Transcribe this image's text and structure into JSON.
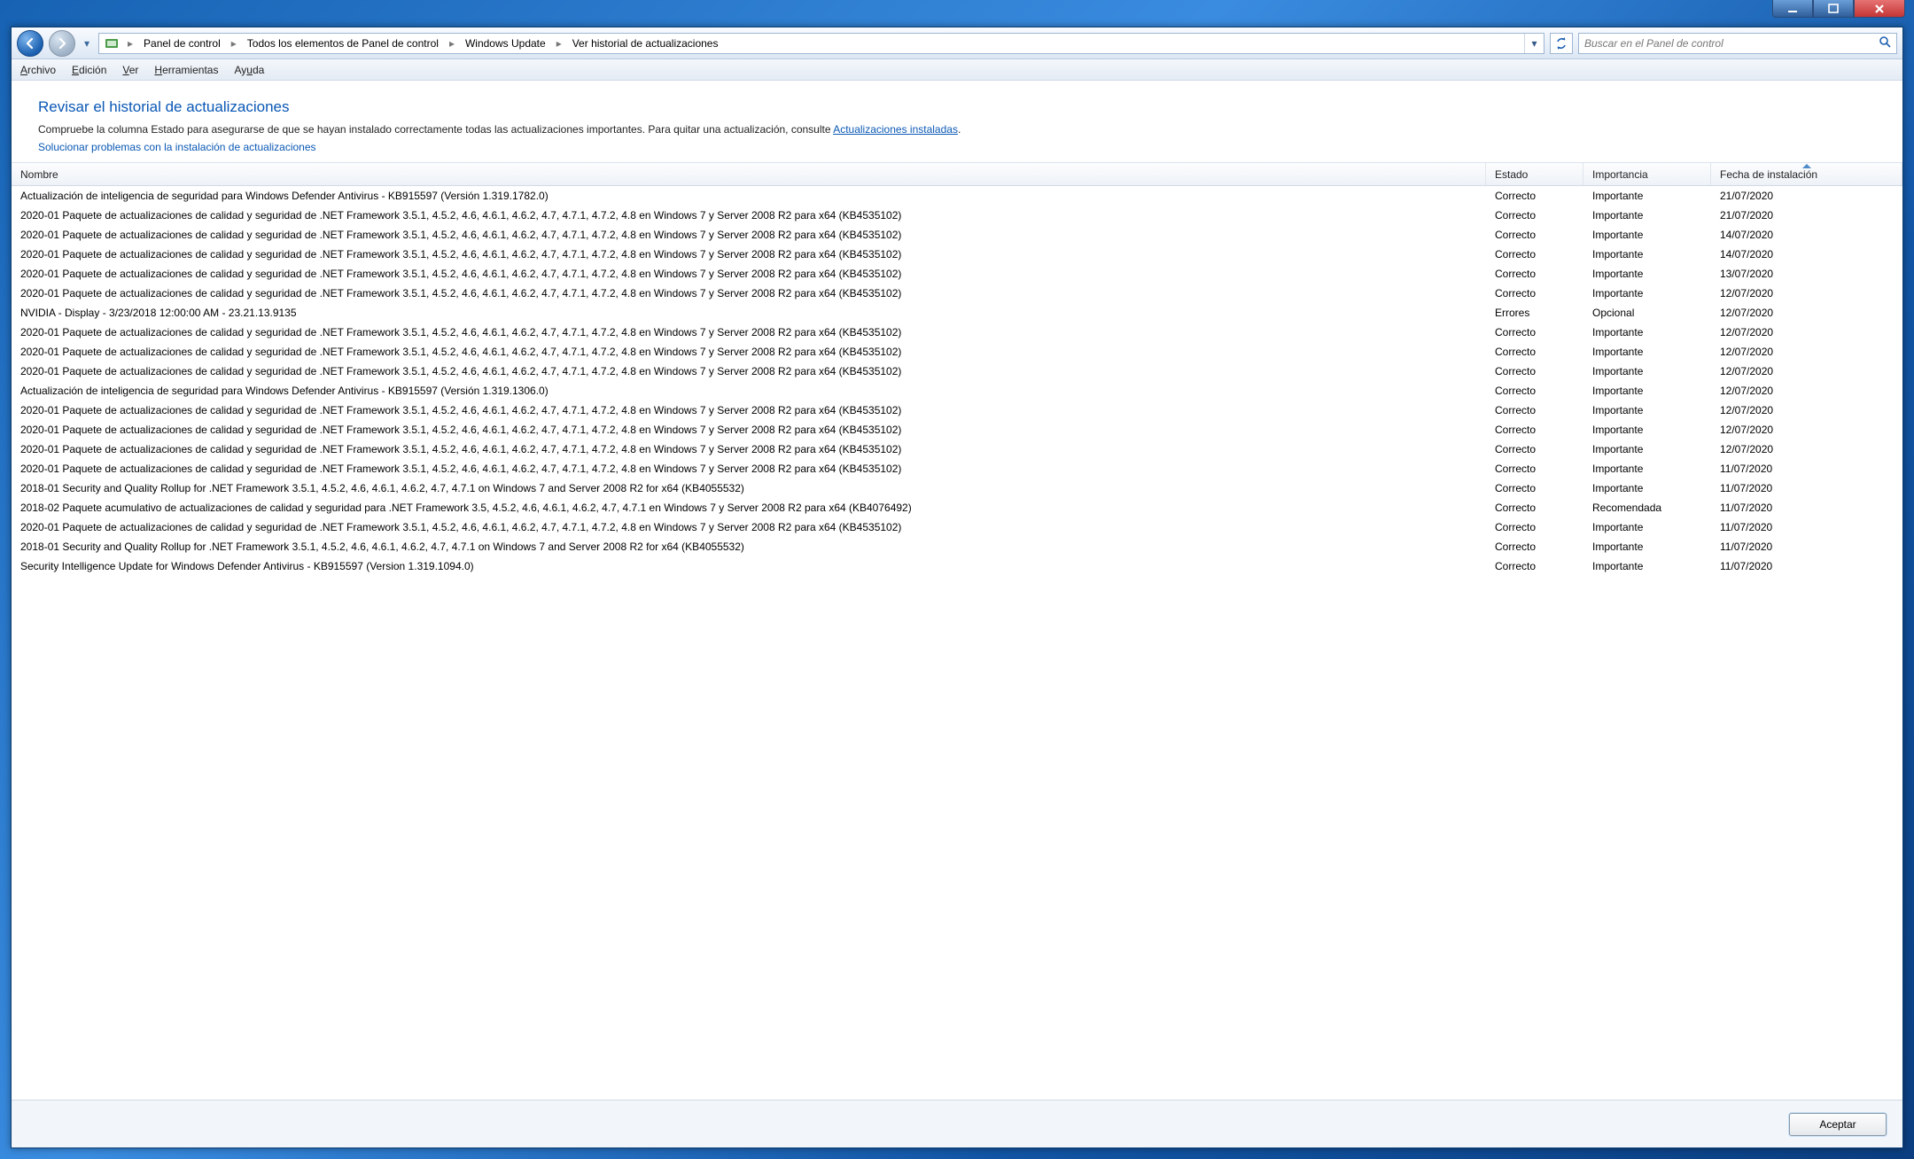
{
  "breadcrumbs": {
    "items": [
      "Panel de control",
      "Todos los elementos de Panel de control",
      "Windows Update",
      "Ver historial de actualizaciones"
    ]
  },
  "search": {
    "placeholder": "Buscar en el Panel de control"
  },
  "menu": {
    "file": "Archivo",
    "edit": "Edición",
    "view": "Ver",
    "tools": "Herramientas",
    "help": "Ayuda"
  },
  "header": {
    "title": "Revisar el historial de actualizaciones",
    "desc_prefix": "Compruebe la columna Estado para asegurarse de que se hayan instalado correctamente todas las actualizaciones importantes. Para quitar una actualización, consulte ",
    "desc_link": "Actualizaciones instaladas",
    "desc_suffix": ".",
    "sub_link": "Solucionar problemas con la instalación de actualizaciones"
  },
  "columns": {
    "name": "Nombre",
    "status": "Estado",
    "importance": "Importancia",
    "date": "Fecha de instalación"
  },
  "rows": [
    {
      "name": "Actualización de inteligencia de seguridad para Windows Defender Antivirus - KB915597 (Versión 1.319.1782.0)",
      "status": "Correcto",
      "importance": "Importante",
      "date": "21/07/2020"
    },
    {
      "name": "2020-01 Paquete de actualizaciones de calidad y seguridad de .NET Framework 3.5.1, 4.5.2, 4.6, 4.6.1, 4.6.2, 4.7, 4.7.1, 4.7.2, 4.8 en Windows 7 y Server 2008 R2 para x64 (KB4535102)",
      "status": "Correcto",
      "importance": "Importante",
      "date": "21/07/2020"
    },
    {
      "name": "2020-01 Paquete de actualizaciones de calidad y seguridad de .NET Framework 3.5.1, 4.5.2, 4.6, 4.6.1, 4.6.2, 4.7, 4.7.1, 4.7.2, 4.8 en Windows 7 y Server 2008 R2 para x64 (KB4535102)",
      "status": "Correcto",
      "importance": "Importante",
      "date": "14/07/2020"
    },
    {
      "name": "2020-01 Paquete de actualizaciones de calidad y seguridad de .NET Framework 3.5.1, 4.5.2, 4.6, 4.6.1, 4.6.2, 4.7, 4.7.1, 4.7.2, 4.8 en Windows 7 y Server 2008 R2 para x64 (KB4535102)",
      "status": "Correcto",
      "importance": "Importante",
      "date": "14/07/2020"
    },
    {
      "name": "2020-01 Paquete de actualizaciones de calidad y seguridad de .NET Framework 3.5.1, 4.5.2, 4.6, 4.6.1, 4.6.2, 4.7, 4.7.1, 4.7.2, 4.8 en Windows 7 y Server 2008 R2 para x64 (KB4535102)",
      "status": "Correcto",
      "importance": "Importante",
      "date": "13/07/2020"
    },
    {
      "name": "2020-01 Paquete de actualizaciones de calidad y seguridad de .NET Framework 3.5.1, 4.5.2, 4.6, 4.6.1, 4.6.2, 4.7, 4.7.1, 4.7.2, 4.8 en Windows 7 y Server 2008 R2 para x64 (KB4535102)",
      "status": "Correcto",
      "importance": "Importante",
      "date": "12/07/2020"
    },
    {
      "name": "NVIDIA - Display - 3/23/2018 12:00:00 AM - 23.21.13.9135",
      "status": "Errores",
      "importance": "Opcional",
      "date": "12/07/2020"
    },
    {
      "name": "2020-01 Paquete de actualizaciones de calidad y seguridad de .NET Framework 3.5.1, 4.5.2, 4.6, 4.6.1, 4.6.2, 4.7, 4.7.1, 4.7.2, 4.8 en Windows 7 y Server 2008 R2 para x64 (KB4535102)",
      "status": "Correcto",
      "importance": "Importante",
      "date": "12/07/2020"
    },
    {
      "name": "2020-01 Paquete de actualizaciones de calidad y seguridad de .NET Framework 3.5.1, 4.5.2, 4.6, 4.6.1, 4.6.2, 4.7, 4.7.1, 4.7.2, 4.8 en Windows 7 y Server 2008 R2 para x64 (KB4535102)",
      "status": "Correcto",
      "importance": "Importante",
      "date": "12/07/2020"
    },
    {
      "name": "2020-01 Paquete de actualizaciones de calidad y seguridad de .NET Framework 3.5.1, 4.5.2, 4.6, 4.6.1, 4.6.2, 4.7, 4.7.1, 4.7.2, 4.8 en Windows 7 y Server 2008 R2 para x64 (KB4535102)",
      "status": "Correcto",
      "importance": "Importante",
      "date": "12/07/2020"
    },
    {
      "name": "Actualización de inteligencia de seguridad para Windows Defender Antivirus - KB915597 (Versión 1.319.1306.0)",
      "status": "Correcto",
      "importance": "Importante",
      "date": "12/07/2020"
    },
    {
      "name": "2020-01 Paquete de actualizaciones de calidad y seguridad de .NET Framework 3.5.1, 4.5.2, 4.6, 4.6.1, 4.6.2, 4.7, 4.7.1, 4.7.2, 4.8 en Windows 7 y Server 2008 R2 para x64 (KB4535102)",
      "status": "Correcto",
      "importance": "Importante",
      "date": "12/07/2020"
    },
    {
      "name": "2020-01 Paquete de actualizaciones de calidad y seguridad de .NET Framework 3.5.1, 4.5.2, 4.6, 4.6.1, 4.6.2, 4.7, 4.7.1, 4.7.2, 4.8 en Windows 7 y Server 2008 R2 para x64 (KB4535102)",
      "status": "Correcto",
      "importance": "Importante",
      "date": "12/07/2020"
    },
    {
      "name": "2020-01 Paquete de actualizaciones de calidad y seguridad de .NET Framework 3.5.1, 4.5.2, 4.6, 4.6.1, 4.6.2, 4.7, 4.7.1, 4.7.2, 4.8 en Windows 7 y Server 2008 R2 para x64 (KB4535102)",
      "status": "Correcto",
      "importance": "Importante",
      "date": "12/07/2020"
    },
    {
      "name": "2020-01 Paquete de actualizaciones de calidad y seguridad de .NET Framework 3.5.1, 4.5.2, 4.6, 4.6.1, 4.6.2, 4.7, 4.7.1, 4.7.2, 4.8 en Windows 7 y Server 2008 R2 para x64 (KB4535102)",
      "status": "Correcto",
      "importance": "Importante",
      "date": "11/07/2020"
    },
    {
      "name": "2018-01 Security and Quality Rollup for .NET Framework 3.5.1, 4.5.2, 4.6, 4.6.1, 4.6.2, 4.7, 4.7.1 on Windows 7 and Server 2008 R2 for x64 (KB4055532)",
      "status": "Correcto",
      "importance": "Importante",
      "date": "11/07/2020"
    },
    {
      "name": "2018-02 Paquete acumulativo de actualizaciones de calidad y seguridad para .NET Framework 3.5, 4.5.2, 4.6, 4.6.1, 4.6.2, 4.7, 4.7.1 en Windows 7 y Server 2008 R2 para x64 (KB4076492)",
      "status": "Correcto",
      "importance": "Recomendada",
      "date": "11/07/2020"
    },
    {
      "name": "2020-01 Paquete de actualizaciones de calidad y seguridad de .NET Framework 3.5.1, 4.5.2, 4.6, 4.6.1, 4.6.2, 4.7, 4.7.1, 4.7.2, 4.8 en Windows 7 y Server 2008 R2 para x64 (KB4535102)",
      "status": "Correcto",
      "importance": "Importante",
      "date": "11/07/2020"
    },
    {
      "name": "2018-01 Security and Quality Rollup for .NET Framework 3.5.1, 4.5.2, 4.6, 4.6.1, 4.6.2, 4.7, 4.7.1 on Windows 7 and Server 2008 R2 for x64 (KB4055532)",
      "status": "Correcto",
      "importance": "Importante",
      "date": "11/07/2020"
    },
    {
      "name": "Security Intelligence Update for Windows Defender Antivirus - KB915597 (Version 1.319.1094.0)",
      "status": "Correcto",
      "importance": "Importante",
      "date": "11/07/2020"
    }
  ],
  "footer": {
    "ok": "Aceptar"
  }
}
